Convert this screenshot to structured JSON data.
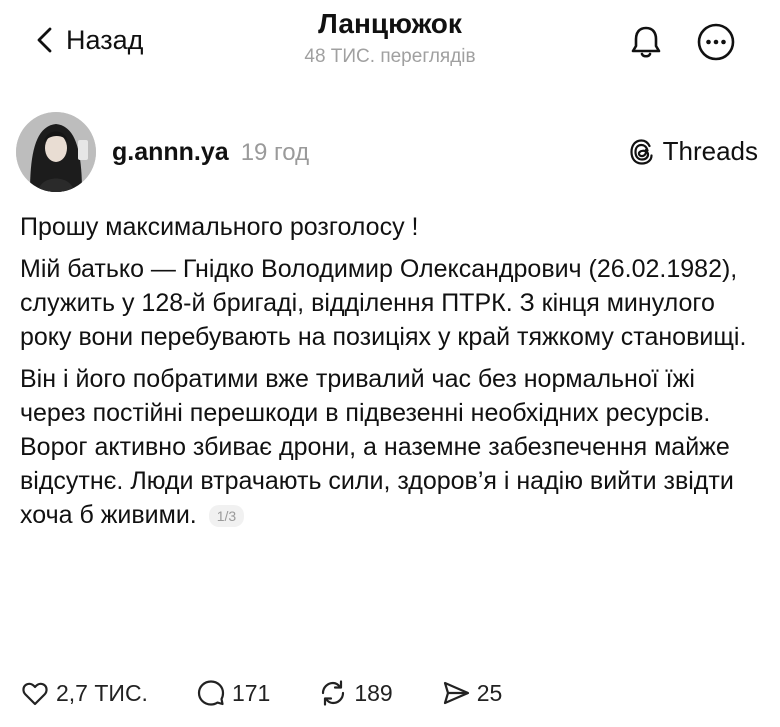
{
  "header": {
    "back_label": "Назад",
    "title": "Ланцюжок",
    "subtitle": "48 ТИС. переглядів",
    "icons": [
      "chevron-left-icon",
      "bell-icon",
      "more-icon"
    ]
  },
  "post": {
    "username": "g.annn.ya",
    "time": "19 год",
    "app_label": "Threads",
    "paragraphs": [
      "Прошу максимального розголосу !",
      "Мій батько — Гнідко Володимир Олександрович (26.02.1982), служить у 128-й бригаді, відділення ПТРК. З кінця минулого року вони перебувають на позиціях у край  тяжкому становищі.",
      "Він і його побратими вже тривалий час без нормальної їжі через постійні перешкоди в підвезенні необхідних ресурсів. Ворог активно збиває дрони, а наземне забезпечення майже відсутнє. Люди втрачають сили, здоров’я і надію вийти звідти хоча б живими."
    ],
    "pager": "1/3"
  },
  "actions": {
    "likes": "2,7 ТИС.",
    "comments": "171",
    "reposts": "189",
    "shares": "25"
  }
}
